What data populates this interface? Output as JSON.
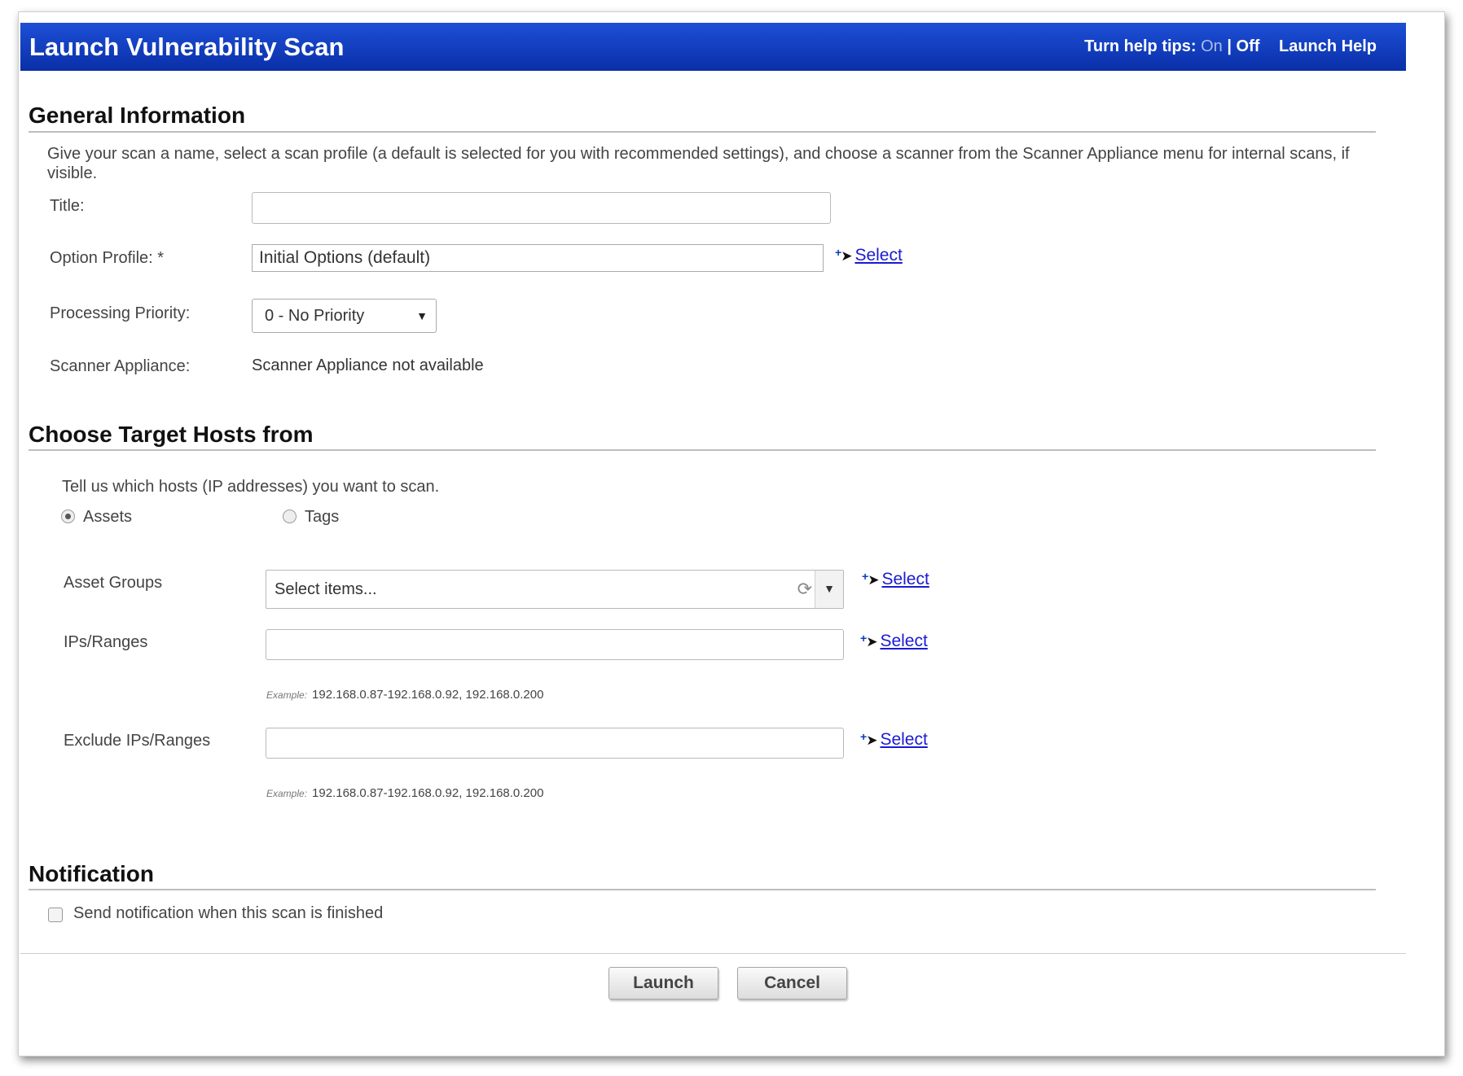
{
  "titlebar": {
    "title": "Launch Vulnerability Scan",
    "help_tips_label": "Turn help tips:",
    "on": "On",
    "separator": "|",
    "off": "Off",
    "launch_help": "Launch Help"
  },
  "general": {
    "heading": "General Information",
    "description": "Give your scan a name, select a scan profile (a default is selected for you with recommended settings), and choose a scanner from the Scanner Appliance menu for internal scans, if visible.",
    "title_label": "Title:",
    "title_value": "",
    "option_profile_label": "Option Profile: *",
    "option_profile_value": "Initial Options (default)",
    "option_profile_select": "Select",
    "priority_label": "Processing Priority:",
    "priority_value": "0 - No Priority",
    "scanner_label": "Scanner Appliance:",
    "scanner_value": "Scanner Appliance not available"
  },
  "targets": {
    "heading": "Choose Target Hosts from",
    "description": "Tell us which hosts (IP addresses) you want to scan.",
    "radio_assets": "Assets",
    "radio_tags": "Tags",
    "selected_radio": "Assets",
    "asset_groups_label": "Asset Groups",
    "asset_groups_placeholder": "Select items...",
    "asset_groups_select": "Select",
    "ips_label": "IPs/Ranges",
    "ips_value": "",
    "ips_select": "Select",
    "ips_example_label": "Example:",
    "ips_example": "192.168.0.87-192.168.0.92, 192.168.0.200",
    "exclude_label": "Exclude IPs/Ranges",
    "exclude_value": "",
    "exclude_select": "Select",
    "exclude_example_label": "Example:",
    "exclude_example": "192.168.0.87-192.168.0.92, 192.168.0.200"
  },
  "notification": {
    "heading": "Notification",
    "checkbox_label": "Send notification when this scan is finished",
    "checked": false
  },
  "buttons": {
    "launch": "Launch",
    "cancel": "Cancel"
  },
  "icons": {
    "refresh": "refresh-icon",
    "dropdown": "chevron-down-icon",
    "select_cursor": "add-cursor-icon"
  },
  "colors": {
    "header_blue": "#1d4fd6",
    "link_blue": "#1a1ad2"
  }
}
